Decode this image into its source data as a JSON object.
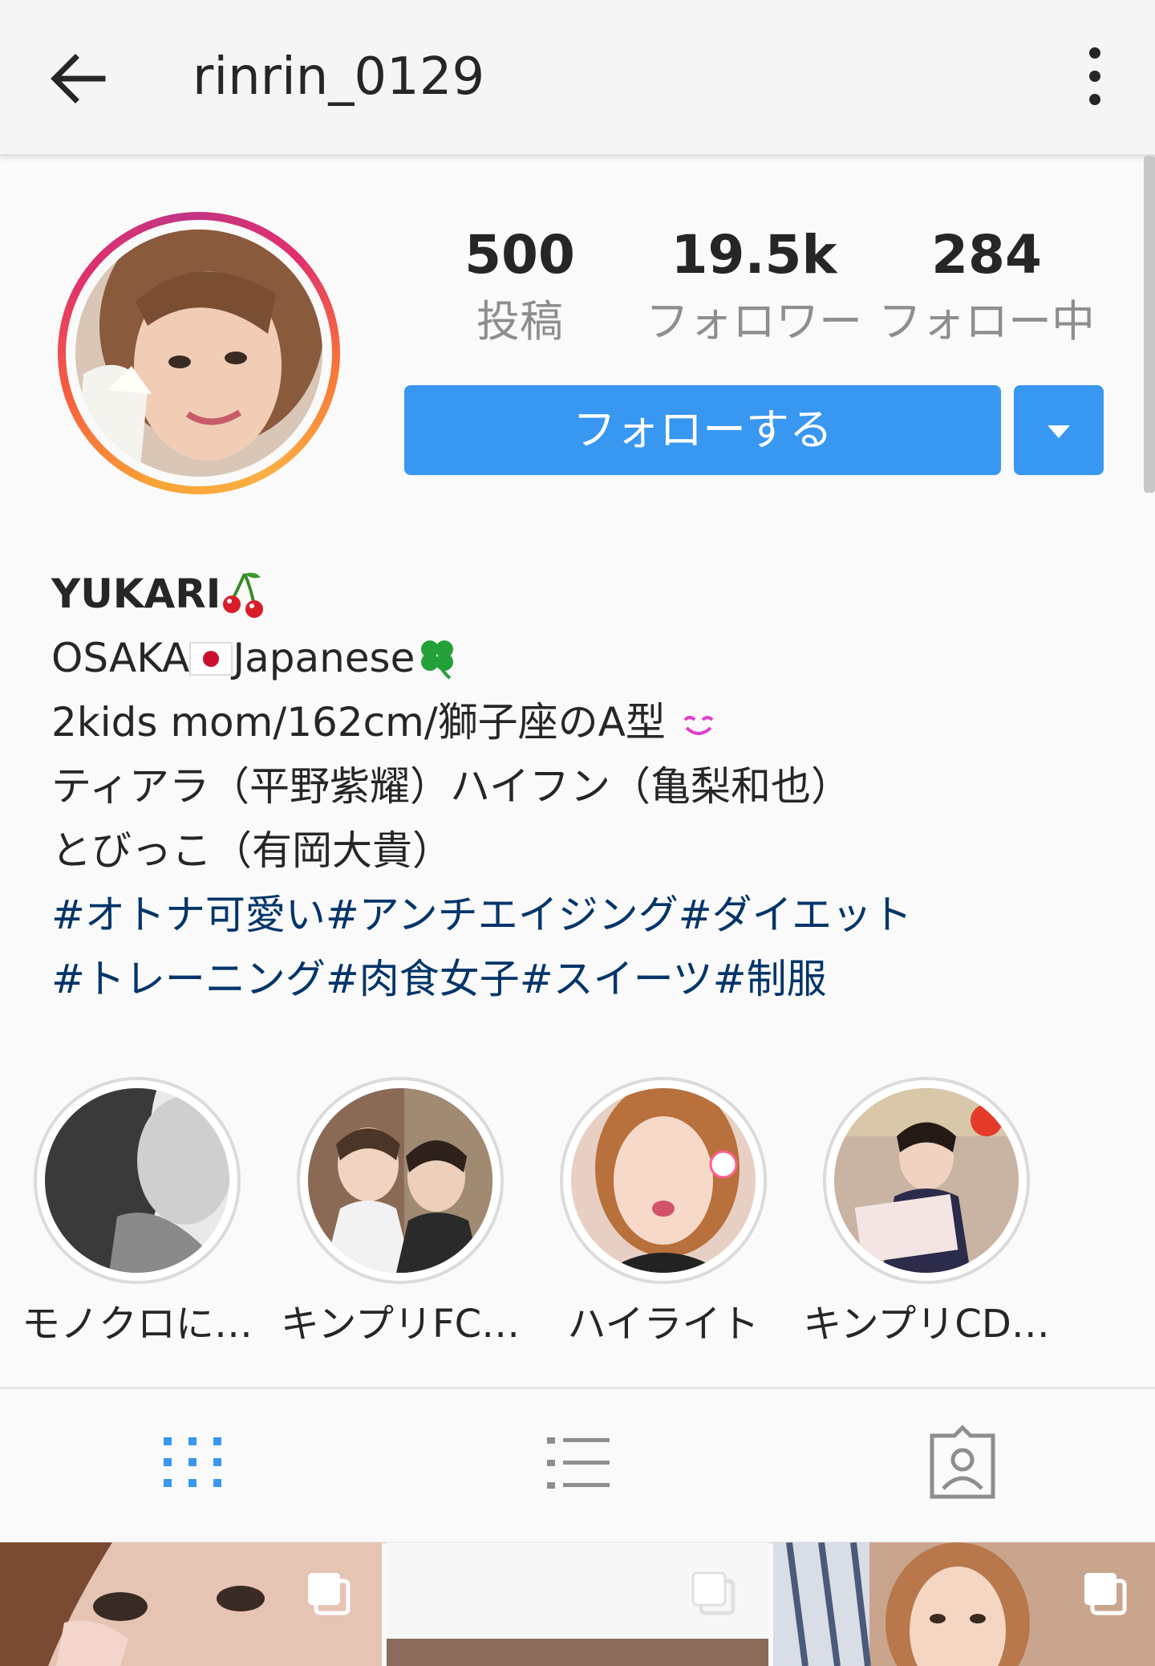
{
  "header": {
    "username": "rinrin_0129",
    "back_icon": "arrow-left-icon",
    "more_icon": "more-vertical-icon"
  },
  "stats": {
    "posts_count": "500",
    "posts_label": "投稿",
    "followers_count": "19.5k",
    "followers_label": "フォロワー",
    "following_count": "284",
    "following_label": "フォロー中"
  },
  "actions": {
    "follow_label": "フォローする",
    "dropdown_icon": "caret-down-icon"
  },
  "bio": {
    "name": "YUKARI",
    "line1_a": "OSAKA",
    "line1_b": "Japanese",
    "line2": "2kids mom/162cm/獅子座のA型",
    "line3": "ティアラ（平野紫耀）ハイフン（亀梨和也）",
    "line4": "とびっこ（有岡大貴）",
    "hashtags1": "#オトナ可愛い#アンチエイジング#ダイエット",
    "hashtags2": "#トレーニング#肉食女子#スイーツ#制服"
  },
  "highlights": [
    {
      "label": "モノクロに…"
    },
    {
      "label": "キンプリFC…"
    },
    {
      "label": "ハイライト"
    },
    {
      "label": "キンプリCD…"
    }
  ],
  "tabs": {
    "grid_icon": "grid-icon",
    "list_icon": "list-icon",
    "tagged_icon": "tagged-person-icon"
  },
  "colors": {
    "accent": "#3897f0",
    "hashtag": "#003569",
    "grid_active": "#3897f0"
  }
}
